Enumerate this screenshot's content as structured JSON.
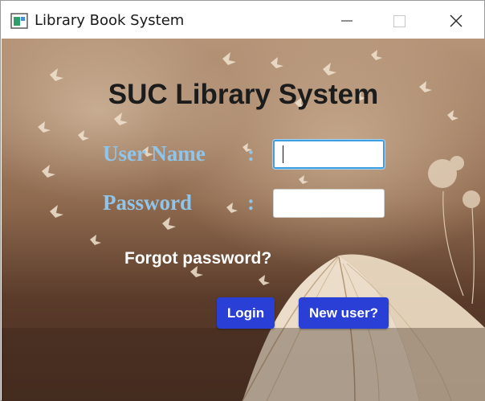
{
  "window": {
    "title": "Library Book System"
  },
  "titlebar": {
    "icons": [
      "app-icon",
      "minimize-icon",
      "maximize-icon",
      "close-icon"
    ]
  },
  "form": {
    "heading": "SUC Library System",
    "username_label": "User Name",
    "password_label": "Password",
    "colon": ":",
    "username_value": "",
    "password_value": "",
    "forgot_link": "Forgot password?",
    "login_button": "Login",
    "new_user_button": "New user?"
  },
  "colors": {
    "label": "#8fc5ea",
    "button": "#2a3fd6",
    "heading": "#1c1c1c",
    "focus_border": "#3f9ee0"
  }
}
